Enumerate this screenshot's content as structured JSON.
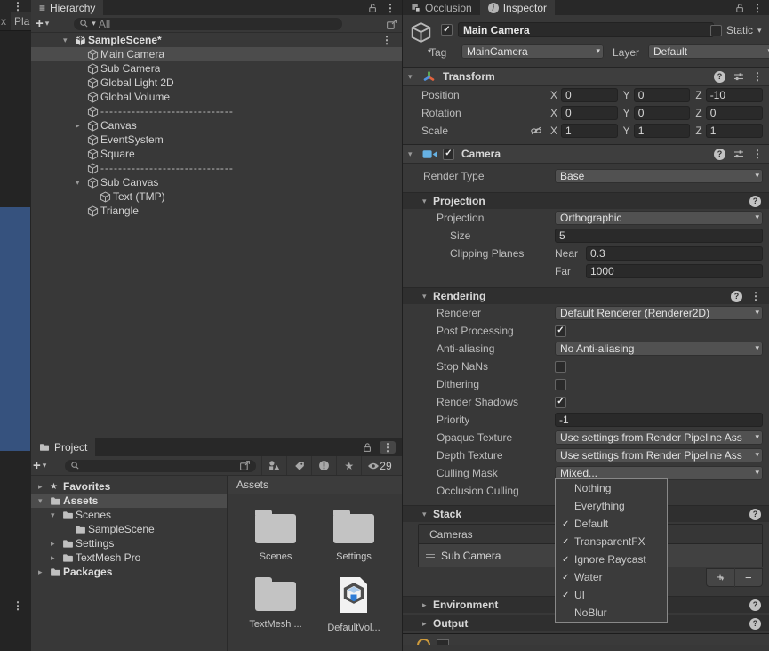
{
  "icons": {
    "kebab": "⋮",
    "hamburger": "≡",
    "caret": "▾",
    "arrow_down": "▾",
    "arrow_right": "▸",
    "check": "✓",
    "plus": "+",
    "minus": "−",
    "star": "★",
    "question": "?",
    "info": "i"
  },
  "left_strip": {
    "partial_tab_a": "x",
    "partial_tab_b": "Pla"
  },
  "hierarchy": {
    "tab_label": "Hierarchy",
    "search_text": "All",
    "scene_name": "SampleScene*",
    "items": [
      {
        "label": "Main Camera",
        "arrow": "",
        "indent": 1,
        "selected": true
      },
      {
        "label": "Sub Camera",
        "arrow": "",
        "indent": 1
      },
      {
        "label": "Global Light 2D",
        "arrow": "",
        "indent": 1
      },
      {
        "label": "Global Volume",
        "arrow": "",
        "indent": 1
      },
      {
        "label": "------------------------------",
        "arrow": "",
        "indent": 1,
        "dim": true
      },
      {
        "label": "Canvas",
        "arrow": "right",
        "indent": 1
      },
      {
        "label": "EventSystem",
        "arrow": "",
        "indent": 1
      },
      {
        "label": "Square",
        "arrow": "",
        "indent": 1
      },
      {
        "label": "------------------------------",
        "arrow": "",
        "indent": 1,
        "dim": true
      },
      {
        "label": "Sub Canvas",
        "arrow": "down",
        "indent": 1
      },
      {
        "label": "Text (TMP)",
        "arrow": "",
        "indent": 2
      },
      {
        "label": "Triangle",
        "arrow": "",
        "indent": 1
      }
    ]
  },
  "project": {
    "tab_label": "Project",
    "eye_count": "29",
    "tree": [
      {
        "label": "Favorites",
        "icon": "star",
        "arrow": "right",
        "indent": 0,
        "bold": true
      },
      {
        "label": "Assets",
        "icon": "folder",
        "arrow": "down",
        "indent": 0,
        "selected": true,
        "bold": true,
        "gap": true
      },
      {
        "label": "Scenes",
        "icon": "folder",
        "arrow": "down",
        "indent": 1
      },
      {
        "label": "SampleScene",
        "icon": "folder",
        "arrow": "",
        "indent": 2
      },
      {
        "label": "Settings",
        "icon": "folder",
        "arrow": "right",
        "indent": 1
      },
      {
        "label": "TextMesh Pro",
        "icon": "folder",
        "arrow": "right",
        "indent": 1
      },
      {
        "label": "Packages",
        "icon": "folder",
        "arrow": "right",
        "indent": 0,
        "bold": true
      }
    ],
    "grid_header": "Assets",
    "grid_items": [
      {
        "label": "Scenes",
        "kind": "folder"
      },
      {
        "label": "Settings",
        "kind": "folder"
      },
      {
        "label": "TextMesh ...",
        "kind": "folder"
      },
      {
        "label": "DefaultVol...",
        "kind": "asset"
      }
    ]
  },
  "inspector": {
    "tab_occlusion": "Occlusion",
    "tab_inspector": "Inspector",
    "go": {
      "name": "Main Camera",
      "static_label": "Static",
      "tag_label": "Tag",
      "tag_value": "MainCamera",
      "layer_label": "Layer",
      "layer_value": "Default"
    },
    "transform": {
      "title": "Transform",
      "axis_x": "X",
      "axis_y": "Y",
      "axis_z": "Z",
      "position": {
        "label": "Position",
        "x": "0",
        "y": "0",
        "z": "-10"
      },
      "rotation": {
        "label": "Rotation",
        "x": "0",
        "y": "0",
        "z": "0"
      },
      "scale": {
        "label": "Scale",
        "x": "1",
        "y": "1",
        "z": "1"
      }
    },
    "camera": {
      "title": "Camera",
      "render_type_label": "Render Type",
      "render_type_value": "Base",
      "projection_title": "Projection",
      "projection_rows": [
        {
          "label": "Projection",
          "type": "dropdown",
          "value": "Orthographic",
          "indent": 1
        },
        {
          "label": "Size",
          "type": "field",
          "value": "5",
          "indent": 2
        },
        {
          "label": "Clipping Planes",
          "type": "subfield",
          "sub": "Near",
          "value": "0.3",
          "indent": 2
        },
        {
          "label": "",
          "type": "subfield",
          "sub": "Far",
          "value": "1000",
          "indent": 2
        }
      ],
      "rendering_title": "Rendering",
      "rendering_rows": [
        {
          "label": "Renderer",
          "type": "dropdown",
          "value": "Default Renderer (Renderer2D)",
          "indent": 1
        },
        {
          "label": "Post Processing",
          "type": "checkbox",
          "checked": true,
          "indent": 1
        },
        {
          "label": "Anti-aliasing",
          "type": "dropdown",
          "value": "No Anti-aliasing",
          "indent": 1
        },
        {
          "label": "Stop NaNs",
          "type": "checkbox",
          "checked": false,
          "indent": 1
        },
        {
          "label": "Dithering",
          "type": "checkbox",
          "checked": false,
          "indent": 1
        },
        {
          "label": "Render Shadows",
          "type": "checkbox",
          "checked": true,
          "indent": 1
        },
        {
          "label": "Priority",
          "type": "field",
          "value": "-1",
          "indent": 1
        },
        {
          "label": "Opaque Texture",
          "type": "dropdown",
          "value": "Use settings from Render Pipeline Ass",
          "indent": 1
        },
        {
          "label": "Depth Texture",
          "type": "dropdown",
          "value": "Use settings from Render Pipeline Ass",
          "indent": 1
        },
        {
          "label": "Culling Mask",
          "type": "dropdown",
          "value": "Mixed...",
          "indent": 1
        },
        {
          "label": "Occlusion Culling",
          "type": "none",
          "indent": 1
        }
      ],
      "stack_title": "Stack",
      "stack_cameras_label": "Cameras",
      "stack_items": [
        {
          "label": "Sub Camera"
        }
      ],
      "foldouts": [
        {
          "label": "Environment"
        },
        {
          "label": "Output"
        }
      ]
    },
    "culling_popup": [
      {
        "label": "Nothing",
        "checked": false
      },
      {
        "label": "Everything",
        "checked": false
      },
      {
        "label": "Default",
        "checked": true
      },
      {
        "label": "TransparentFX",
        "checked": true
      },
      {
        "label": "Ignore Raycast",
        "checked": true
      },
      {
        "label": "Water",
        "checked": true
      },
      {
        "label": "UI",
        "checked": true
      },
      {
        "label": "NoBlur",
        "checked": false
      }
    ]
  },
  "colors": {
    "panel": "#383838",
    "dark": "#282828",
    "field": "#2a2a2a",
    "dropdown": "#515151",
    "selection": "#4c4c4c",
    "scene_blue": "#36527e",
    "camera_icon": "#66b1e3"
  }
}
